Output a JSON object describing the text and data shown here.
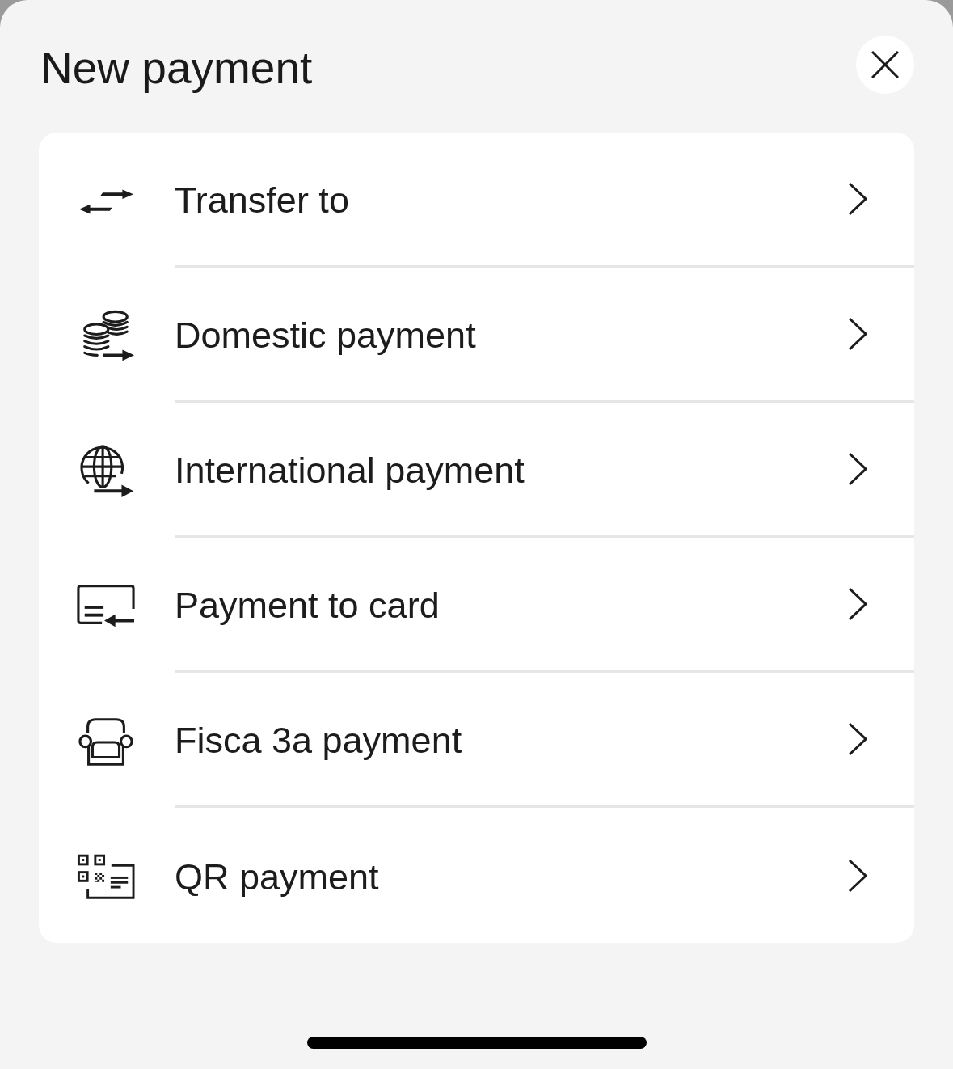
{
  "header": {
    "title": "New payment"
  },
  "options": [
    {
      "label": "Transfer to",
      "kind": "transfer"
    },
    {
      "label": "Domestic payment",
      "kind": "coins"
    },
    {
      "label": "International payment",
      "kind": "globe"
    },
    {
      "label": "Payment to card",
      "kind": "card"
    },
    {
      "label": "Fisca 3a payment",
      "kind": "armchair"
    },
    {
      "label": "QR payment",
      "kind": "qr"
    }
  ]
}
